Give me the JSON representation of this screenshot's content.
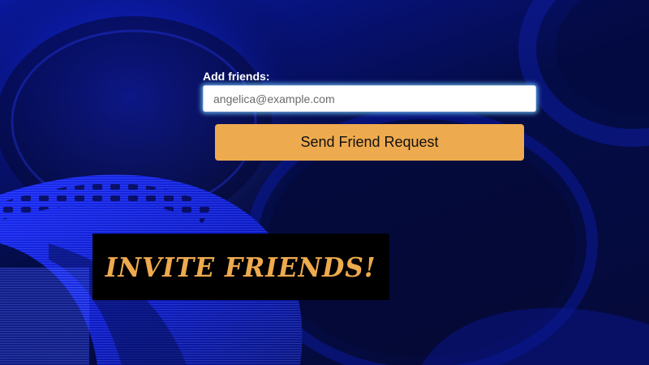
{
  "add_friends": {
    "label": "Add friends:",
    "email_placeholder": "angelica@example.com",
    "email_value": "",
    "send_button_label": "Send Friend Request"
  },
  "banner": {
    "text": "INVITE FRIENDS!"
  },
  "background": {
    "image": "blue-film-reel-artwork"
  },
  "colors": {
    "accent": "#eeaa4e",
    "background_dark": "#050a3a",
    "background_blue": "#0a1aa8",
    "banner_bg": "#000000",
    "input_glow": "#6ec8ff"
  }
}
